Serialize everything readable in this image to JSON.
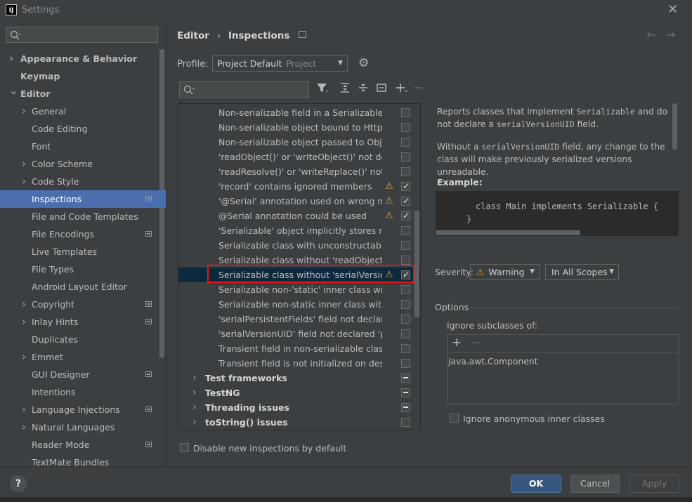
{
  "window": {
    "title": "Settings",
    "app_icon": "IJ"
  },
  "sidebar": {
    "items": [
      {
        "label": "Appearance & Behavior",
        "bold": true,
        "arrow": "right",
        "indent": 0
      },
      {
        "label": "Keymap",
        "bold": true,
        "arrow": "",
        "indent": 0
      },
      {
        "label": "Editor",
        "bold": true,
        "arrow": "down",
        "indent": 0
      },
      {
        "label": "General",
        "bold": false,
        "arrow": "right",
        "indent": 1
      },
      {
        "label": "Code Editing",
        "bold": false,
        "arrow": "",
        "indent": 1
      },
      {
        "label": "Font",
        "bold": false,
        "arrow": "",
        "indent": 1
      },
      {
        "label": "Color Scheme",
        "bold": false,
        "arrow": "right",
        "indent": 1
      },
      {
        "label": "Code Style",
        "bold": false,
        "arrow": "right",
        "indent": 1
      },
      {
        "label": "Inspections",
        "bold": false,
        "arrow": "",
        "indent": 1,
        "selected": true,
        "project_icon": true
      },
      {
        "label": "File and Code Templates",
        "bold": false,
        "arrow": "",
        "indent": 1
      },
      {
        "label": "File Encodings",
        "bold": false,
        "arrow": "",
        "indent": 1,
        "project_icon": true
      },
      {
        "label": "Live Templates",
        "bold": false,
        "arrow": "",
        "indent": 1
      },
      {
        "label": "File Types",
        "bold": false,
        "arrow": "",
        "indent": 1
      },
      {
        "label": "Android Layout Editor",
        "bold": false,
        "arrow": "",
        "indent": 1
      },
      {
        "label": "Copyright",
        "bold": false,
        "arrow": "right",
        "indent": 1,
        "project_icon": true
      },
      {
        "label": "Inlay Hints",
        "bold": false,
        "arrow": "right",
        "indent": 1,
        "project_icon": true
      },
      {
        "label": "Duplicates",
        "bold": false,
        "arrow": "",
        "indent": 1
      },
      {
        "label": "Emmet",
        "bold": false,
        "arrow": "right",
        "indent": 1
      },
      {
        "label": "GUI Designer",
        "bold": false,
        "arrow": "",
        "indent": 1,
        "project_icon": true
      },
      {
        "label": "Intentions",
        "bold": false,
        "arrow": "",
        "indent": 1
      },
      {
        "label": "Language Injections",
        "bold": false,
        "arrow": "right",
        "indent": 1,
        "project_icon": true
      },
      {
        "label": "Natural Languages",
        "bold": false,
        "arrow": "right",
        "indent": 1
      },
      {
        "label": "Reader Mode",
        "bold": false,
        "arrow": "",
        "indent": 1,
        "project_icon": true
      },
      {
        "label": "TextMate Bundles",
        "bold": false,
        "arrow": "",
        "indent": 1
      }
    ]
  },
  "header": {
    "breadcrumb_parent": "Editor",
    "breadcrumb_sep": "›",
    "breadcrumb_current": "Inspections"
  },
  "profile": {
    "label": "Profile:",
    "value": "Project Default",
    "sub": "Project"
  },
  "inspections": [
    {
      "label": "Non-serializable field in a Serializable class",
      "state": "unchecked",
      "warn": false
    },
    {
      "label": "Non-serializable object bound to HttpSession",
      "state": "unchecked",
      "warn": false
    },
    {
      "label": "Non-serializable object passed to ObjectOutputStream",
      "state": "unchecked",
      "warn": false
    },
    {
      "label": "'readObject()' or 'writeObject()' not declared private",
      "state": "unchecked",
      "warn": false
    },
    {
      "label": "'readResolve()' or 'writeReplace()' not declared protected",
      "state": "unchecked",
      "warn": false
    },
    {
      "label": "'record' contains ignored members",
      "state": "checked",
      "warn": true
    },
    {
      "label": "'@Serial' annotation used on wrong member",
      "state": "checked",
      "warn": true
    },
    {
      "label": "@Serial annotation could be used",
      "state": "checked",
      "warn": true
    },
    {
      "label": "'Serializable' object implicitly stores non-'Serializable' object",
      "state": "unchecked",
      "warn": false
    },
    {
      "label": "Serializable class with unconstructable ancestor",
      "state": "unchecked",
      "warn": false
    },
    {
      "label": "Serializable class without 'readObject()' and 'writeObject()'",
      "state": "unchecked",
      "warn": false
    },
    {
      "label": "Serializable class without 'serialVersionUID'",
      "state": "checked",
      "warn": true,
      "selected": true
    },
    {
      "label": "Serializable non-'static' inner class without 'serialVersionUID'",
      "state": "unchecked",
      "warn": false
    },
    {
      "label": "Serializable non-static inner class without 'serialVersionUID'",
      "state": "unchecked",
      "warn": false
    },
    {
      "label": "'serialPersistentFields' field not declared 'private static final'",
      "state": "unchecked",
      "warn": false
    },
    {
      "label": "'serialVersionUID' field not declared 'private static final long'",
      "state": "unchecked",
      "warn": false
    },
    {
      "label": "Transient field in non-serializable class",
      "state": "unchecked",
      "warn": false
    },
    {
      "label": "Transient field is not initialized on deserialization",
      "state": "unchecked",
      "warn": false
    },
    {
      "label": "Test frameworks",
      "state": "partial",
      "warn": false,
      "group": true
    },
    {
      "label": "TestNG",
      "state": "partial",
      "warn": false,
      "group": true
    },
    {
      "label": "Threading issues",
      "state": "partial",
      "warn": false,
      "group": true
    },
    {
      "label": "toString() issues",
      "state": "unchecked",
      "warn": false,
      "group": true
    }
  ],
  "disable_new": {
    "label": "Disable new inspections by default"
  },
  "description": {
    "p1_a": "Reports classes that implement ",
    "p1_code1": "Serializable",
    "p1_b": " and do not declare a ",
    "p1_code2": "serialVersionUID",
    "p1_c": " field.",
    "p2_a": "Without a ",
    "p2_code": "serialVersionUID",
    "p2_b": " field, any change to the class will make previously serialized versions unreadable.",
    "example_label": "Example:",
    "code_line1": "class Main implements Serializable {",
    "code_line2": "}"
  },
  "severity": {
    "label": "Severity:",
    "value": "Warning",
    "scope": "In All Scopes"
  },
  "options": {
    "title": "Options",
    "ignore_label": "Ignore subclasses of:",
    "ignore_items": [
      "java.awt.Component"
    ],
    "anon_label": "Ignore anonymous inner classes"
  },
  "buttons": {
    "help": "?",
    "ok": "OK",
    "cancel": "Cancel",
    "apply": "Apply"
  },
  "colors": {
    "selection": "#4b6eaf",
    "list_selection": "#0d293e",
    "warning": "#e2a53a",
    "highlight_box": "#e8141a",
    "ok_button": "#365880"
  }
}
